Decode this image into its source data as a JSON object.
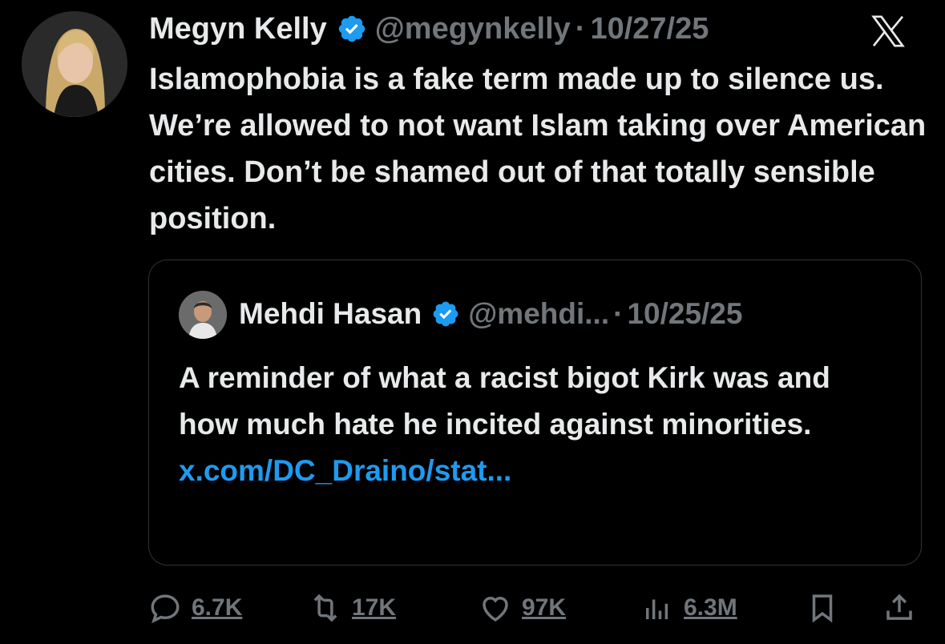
{
  "tweet": {
    "author_name": "Megyn Kelly",
    "handle": "@megynkelly",
    "separator": "·",
    "date": "10/27/25",
    "text": "Islamophobia is a fake term made up to silence us. We’re allowed to not want Islam taking over American cities. Don’t be shamed out of that totally sensible position."
  },
  "quote": {
    "author_name": "Mehdi Hasan",
    "handle": "@mehdi...",
    "separator": "·",
    "date": "10/25/25",
    "text": "A reminder of what a racist bigot Kirk was and how much hate he incited against minorities. ",
    "link_text": "x.com/DC_Draino/​stat..."
  },
  "actions": {
    "replies": "6.7K",
    "reposts": "17K",
    "likes": "97K",
    "views": "6.3M"
  },
  "colors": {
    "background": "#000000",
    "text": "#e7e9ea",
    "muted": "#71767b",
    "accent": "#1d9bf0"
  },
  "icons": [
    "verified-badge-icon",
    "x-logo-icon",
    "reply-icon",
    "repost-icon",
    "like-icon",
    "views-icon",
    "bookmark-icon",
    "share-icon"
  ]
}
